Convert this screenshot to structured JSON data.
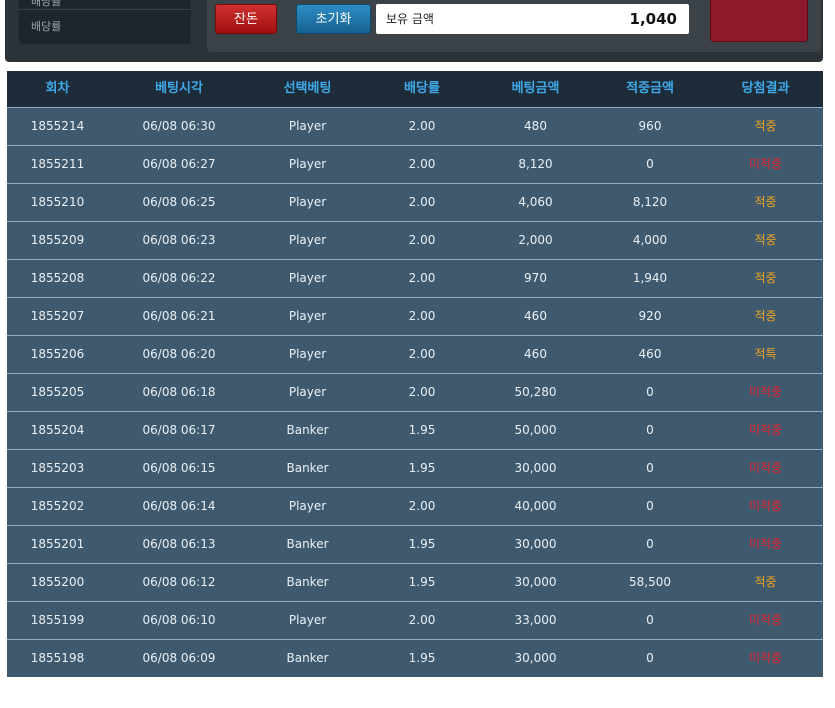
{
  "sidebar": {
    "rows": [
      "배당률 ",
      "배당률"
    ]
  },
  "controls": {
    "cancel_label": "잔돈",
    "reset_label": "초기화",
    "balance_label": "보유 금액",
    "balance_value": "1,040"
  },
  "table": {
    "headers": [
      "회차",
      "베팅시각",
      "선택베팅",
      "배당률",
      "베팅금액",
      "적중금액",
      "당첨결과"
    ],
    "rows": [
      {
        "round": "1855214",
        "time": "06/08 06:30",
        "pick": "Player",
        "odds": "2.00",
        "bet": "480",
        "payout": "960",
        "result": "적중",
        "status": "win"
      },
      {
        "round": "1855211",
        "time": "06/08 06:27",
        "pick": "Player",
        "odds": "2.00",
        "bet": "8,120",
        "payout": "0",
        "result": "미적중",
        "status": "lose"
      },
      {
        "round": "1855210",
        "time": "06/08 06:25",
        "pick": "Player",
        "odds": "2.00",
        "bet": "4,060",
        "payout": "8,120",
        "result": "적중",
        "status": "win"
      },
      {
        "round": "1855209",
        "time": "06/08 06:23",
        "pick": "Player",
        "odds": "2.00",
        "bet": "2,000",
        "payout": "4,000",
        "result": "적중",
        "status": "win"
      },
      {
        "round": "1855208",
        "time": "06/08 06:22",
        "pick": "Player",
        "odds": "2.00",
        "bet": "970",
        "payout": "1,940",
        "result": "적중",
        "status": "win"
      },
      {
        "round": "1855207",
        "time": "06/08 06:21",
        "pick": "Player",
        "odds": "2.00",
        "bet": "460",
        "payout": "920",
        "result": "적중",
        "status": "win"
      },
      {
        "round": "1855206",
        "time": "06/08 06:20",
        "pick": "Player",
        "odds": "2.00",
        "bet": "460",
        "payout": "460",
        "result": "적특",
        "status": "win"
      },
      {
        "round": "1855205",
        "time": "06/08 06:18",
        "pick": "Player",
        "odds": "2.00",
        "bet": "50,280",
        "payout": "0",
        "result": "미적중",
        "status": "lose"
      },
      {
        "round": "1855204",
        "time": "06/08 06:17",
        "pick": "Banker",
        "odds": "1.95",
        "bet": "50,000",
        "payout": "0",
        "result": "미적중",
        "status": "lose"
      },
      {
        "round": "1855203",
        "time": "06/08 06:15",
        "pick": "Banker",
        "odds": "1.95",
        "bet": "30,000",
        "payout": "0",
        "result": "미적중",
        "status": "lose"
      },
      {
        "round": "1855202",
        "time": "06/08 06:14",
        "pick": "Player",
        "odds": "2.00",
        "bet": "40,000",
        "payout": "0",
        "result": "미적중",
        "status": "lose"
      },
      {
        "round": "1855201",
        "time": "06/08 06:13",
        "pick": "Banker",
        "odds": "1.95",
        "bet": "30,000",
        "payout": "0",
        "result": "미적중",
        "status": "lose"
      },
      {
        "round": "1855200",
        "time": "06/08 06:12",
        "pick": "Banker",
        "odds": "1.95",
        "bet": "30,000",
        "payout": "58,500",
        "result": "적중",
        "status": "win"
      },
      {
        "round": "1855199",
        "time": "06/08 06:10",
        "pick": "Player",
        "odds": "2.00",
        "bet": "33,000",
        "payout": "0",
        "result": "미적중",
        "status": "lose"
      },
      {
        "round": "1855198",
        "time": "06/08 06:09",
        "pick": "Banker",
        "odds": "1.95",
        "bet": "30,000",
        "payout": "0",
        "result": "미적중",
        "status": "lose"
      }
    ]
  },
  "colors": {
    "win": "#f0a51e",
    "lose": "#e8242c",
    "header_text": "#3fa9e8"
  }
}
